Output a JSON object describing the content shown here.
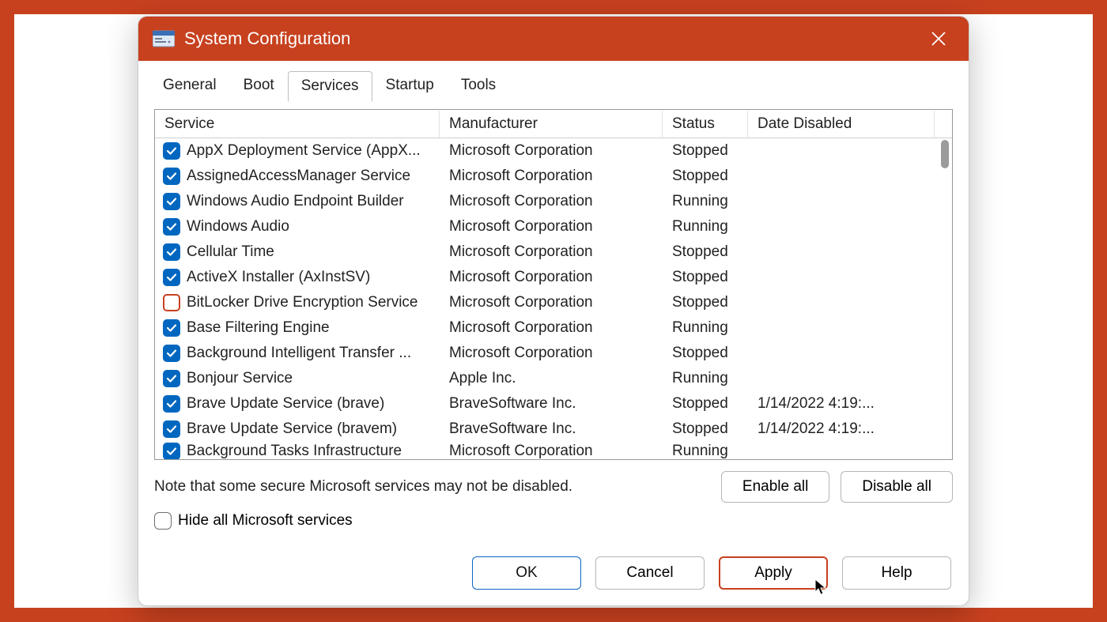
{
  "window": {
    "title": "System Configuration"
  },
  "tabs": {
    "items": [
      "General",
      "Boot",
      "Services",
      "Startup",
      "Tools"
    ],
    "active_index": 2
  },
  "columns": {
    "service": "Service",
    "manufacturer": "Manufacturer",
    "status": "Status",
    "date_disabled": "Date Disabled"
  },
  "services": [
    {
      "checked": true,
      "name": "AppX Deployment Service (AppX...",
      "manufacturer": "Microsoft Corporation",
      "status": "Stopped",
      "date_disabled": ""
    },
    {
      "checked": true,
      "name": "AssignedAccessManager Service",
      "manufacturer": "Microsoft Corporation",
      "status": "Stopped",
      "date_disabled": ""
    },
    {
      "checked": true,
      "name": "Windows Audio Endpoint Builder",
      "manufacturer": "Microsoft Corporation",
      "status": "Running",
      "date_disabled": ""
    },
    {
      "checked": true,
      "name": "Windows Audio",
      "manufacturer": "Microsoft Corporation",
      "status": "Running",
      "date_disabled": ""
    },
    {
      "checked": true,
      "name": "Cellular Time",
      "manufacturer": "Microsoft Corporation",
      "status": "Stopped",
      "date_disabled": ""
    },
    {
      "checked": true,
      "name": "ActiveX Installer (AxInstSV)",
      "manufacturer": "Microsoft Corporation",
      "status": "Stopped",
      "date_disabled": ""
    },
    {
      "checked": false,
      "name": "BitLocker Drive Encryption Service",
      "manufacturer": "Microsoft Corporation",
      "status": "Stopped",
      "date_disabled": ""
    },
    {
      "checked": true,
      "name": "Base Filtering Engine",
      "manufacturer": "Microsoft Corporation",
      "status": "Running",
      "date_disabled": ""
    },
    {
      "checked": true,
      "name": "Background Intelligent Transfer ...",
      "manufacturer": "Microsoft Corporation",
      "status": "Stopped",
      "date_disabled": ""
    },
    {
      "checked": true,
      "name": "Bonjour Service",
      "manufacturer": "Apple Inc.",
      "status": "Running",
      "date_disabled": ""
    },
    {
      "checked": true,
      "name": "Brave Update Service (brave)",
      "manufacturer": "BraveSoftware Inc.",
      "status": "Stopped",
      "date_disabled": "1/14/2022 4:19:..."
    },
    {
      "checked": true,
      "name": "Brave Update Service (bravem)",
      "manufacturer": "BraveSoftware Inc.",
      "status": "Stopped",
      "date_disabled": "1/14/2022 4:19:..."
    },
    {
      "checked": true,
      "name": "Background Tasks Infrastructure",
      "manufacturer": "Microsoft Corporation",
      "status": "Running",
      "date_disabled": ""
    }
  ],
  "note": "Note that some secure Microsoft services may not be disabled.",
  "buttons": {
    "enable_all": "Enable all",
    "disable_all": "Disable all"
  },
  "hide_label": "Hide all Microsoft services",
  "footer": {
    "ok": "OK",
    "cancel": "Cancel",
    "apply": "Apply",
    "help": "Help"
  }
}
